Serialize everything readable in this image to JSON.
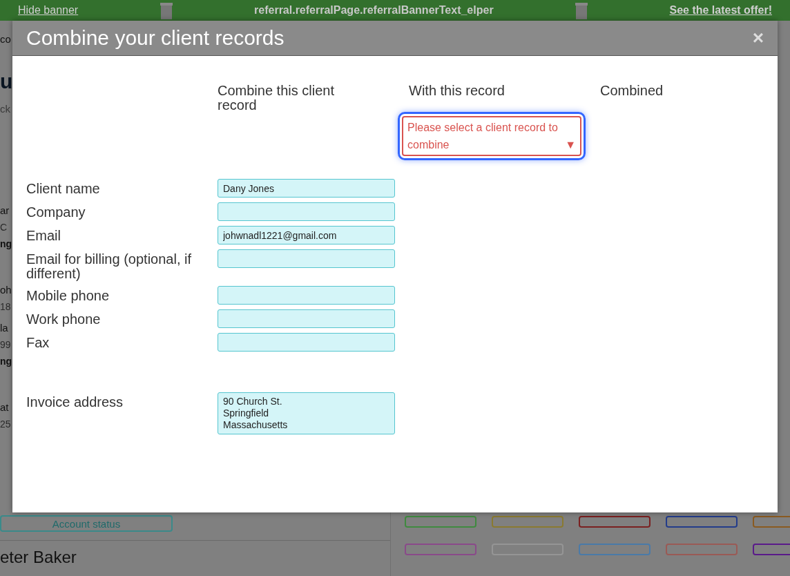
{
  "banner": {
    "hide_link": "Hide banner",
    "text": "referral.referralPage.referralBannerText_elper",
    "offer_link": "See the latest offer!"
  },
  "background": {
    "fragments": [
      {
        "text": "co",
        "kind": "heading"
      },
      {
        "text": "u",
        "kind": "title"
      },
      {
        "text": "ck",
        "kind": "search"
      },
      {
        "text": "ar",
        "kind": "name"
      },
      {
        "text": "C",
        "kind": "detail"
      },
      {
        "text": "ng",
        "kind": "bold"
      },
      {
        "text": "oh",
        "kind": "name"
      },
      {
        "text": "18",
        "kind": "detail"
      },
      {
        "text": "la",
        "kind": "name"
      },
      {
        "text": "99",
        "kind": "detail"
      },
      {
        "text": "ng",
        "kind": "bold"
      },
      {
        "text": "at",
        "kind": "name"
      },
      {
        "text": "25",
        "kind": "detail"
      }
    ],
    "account_status": "Account status",
    "next_client": "eter Baker",
    "pills": [
      {
        "color": "#3f8a3f"
      },
      {
        "color": "#8a7a30"
      },
      {
        "color": "#7a2020"
      },
      {
        "color": "#233c8a"
      },
      {
        "color": "#8a5a20"
      },
      {
        "color": "#8a4a8a"
      },
      {
        "color": "#959595"
      },
      {
        "color": "#4a7aa8"
      },
      {
        "color": "#9a5a55"
      },
      {
        "color": "#5a1a8a"
      }
    ]
  },
  "modal": {
    "title": "Combine your client records",
    "close": "×",
    "columns": [
      "Combine this client record",
      "With this record",
      "Combined"
    ],
    "dropdown": {
      "placeholder": "Please select a client record to combine",
      "arrow": "▼",
      "focused": true
    },
    "fields": [
      {
        "label": "Client name",
        "value": "Dany Jones",
        "kind": "input"
      },
      {
        "label": "Company",
        "kind": "input"
      },
      {
        "label": "Email",
        "value": "johwnadl1221@gmail.com",
        "kind": "input"
      },
      {
        "label": "Email for billing (optional, if different)",
        "kind": "input"
      },
      {
        "label": "Mobile phone",
        "kind": "input"
      },
      {
        "label": "Work phone",
        "kind": "input"
      },
      {
        "label": "Fax",
        "kind": "input"
      },
      {
        "label": "Invoice address",
        "value": "90 Church St.\nSpringfield\nMassachusetts",
        "kind": "address"
      }
    ]
  }
}
